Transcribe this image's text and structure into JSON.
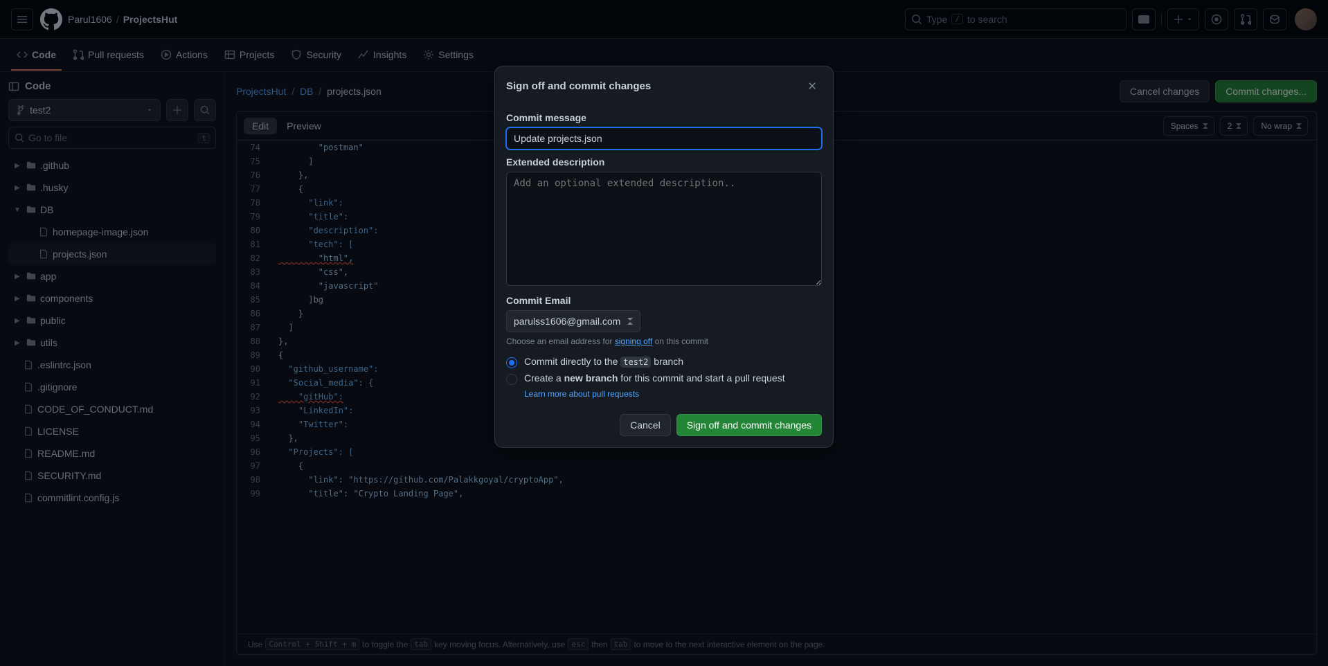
{
  "header": {
    "owner": "Parul1606",
    "repo": "ProjectsHut",
    "search_placeholder_prefix": "Type ",
    "search_key": "/",
    "search_placeholder_suffix": " to search"
  },
  "repo_tabs": {
    "code": "Code",
    "pulls": "Pull requests",
    "actions": "Actions",
    "projects": "Projects",
    "security": "Security",
    "insights": "Insights",
    "settings": "Settings"
  },
  "sidebar": {
    "title": "Code",
    "branch": "test2",
    "file_search_placeholder": "Go to file",
    "file_search_key": "t",
    "tree": {
      "github": ".github",
      "husky": ".husky",
      "db": "DB",
      "homepage": "homepage-image.json",
      "projects": "projects.json",
      "app": "app",
      "components": "components",
      "public": "public",
      "utils": "utils",
      "eslintrc": ".eslintrc.json",
      "gitignore": ".gitignore",
      "coc": "CODE_OF_CONDUCT.md",
      "license": "LICENSE",
      "readme": "README.md",
      "security": "SECURITY.md",
      "commitlint": "commitlint.config.js"
    }
  },
  "path": {
    "root": "ProjectsHut",
    "seg1": "DB",
    "file": "projects.json"
  },
  "buttons": {
    "cancel_changes": "Cancel changes",
    "commit_changes": "Commit changes..."
  },
  "editor": {
    "edit": "Edit",
    "preview": "Preview",
    "indent_mode": "Spaces",
    "indent_size": "2",
    "wrap": "No wrap"
  },
  "code": {
    "l74": "        \"postman\"",
    "l75": "      ]",
    "l76": "    },",
    "l77": "    {",
    "l78k": "      \"link\":",
    "l79k": "      \"title\":",
    "l80k": "      \"description\":",
    "l81k": "      \"tech\": [",
    "l82": "        \"html\",",
    "l83": "        \"css\",",
    "l84": "        \"javascript\"",
    "l85": "      ]bg",
    "l86": "    }",
    "l87": "  ]",
    "l88": "},",
    "l89": "{",
    "l90k": "  \"github_username\":",
    "l91k": "  \"Social_media\": {",
    "l92k": "    \"gitHub\":",
    "l93k": "    \"LinkedIn\":",
    "l94k": "    \"Twitter\":",
    "l95": "  },",
    "l96k": "  \"Projects\": [",
    "l97": "    {",
    "l98": "      \"link\": \"https://github.com/Palakkgoyal/cryptoApp\",",
    "l99": "      \"title\": \"Crypto Landing Page\","
  },
  "footer": {
    "p1": "Use ",
    "k1": "Control + Shift + m",
    "p2": " to toggle the ",
    "k2": "tab",
    "p3": " key moving focus. Alternatively, use ",
    "k3": "esc",
    "p4": " then ",
    "k4": "tab",
    "p5": " to move to the next interactive element on the page."
  },
  "modal": {
    "title": "Sign off and commit changes",
    "commit_msg_label": "Commit message",
    "commit_msg_value": "Update projects.json",
    "ext_desc_label": "Extended description",
    "ext_desc_placeholder": "Add an optional extended description..",
    "email_label": "Commit Email",
    "email_value": "parulss1606@gmail.com",
    "email_hint_1": "Choose an email address for ",
    "email_hint_link": "signing off",
    "email_hint_2": " on this commit",
    "radio1_p1": "Commit directly to the ",
    "radio1_branch": "test2",
    "radio1_p2": " branch",
    "radio2_p1": "Create a ",
    "radio2_bold": "new branch",
    "radio2_p2": " for this commit and start a pull request",
    "radio2_link": "Learn more about pull requests",
    "cancel": "Cancel",
    "submit": "Sign off and commit changes"
  }
}
